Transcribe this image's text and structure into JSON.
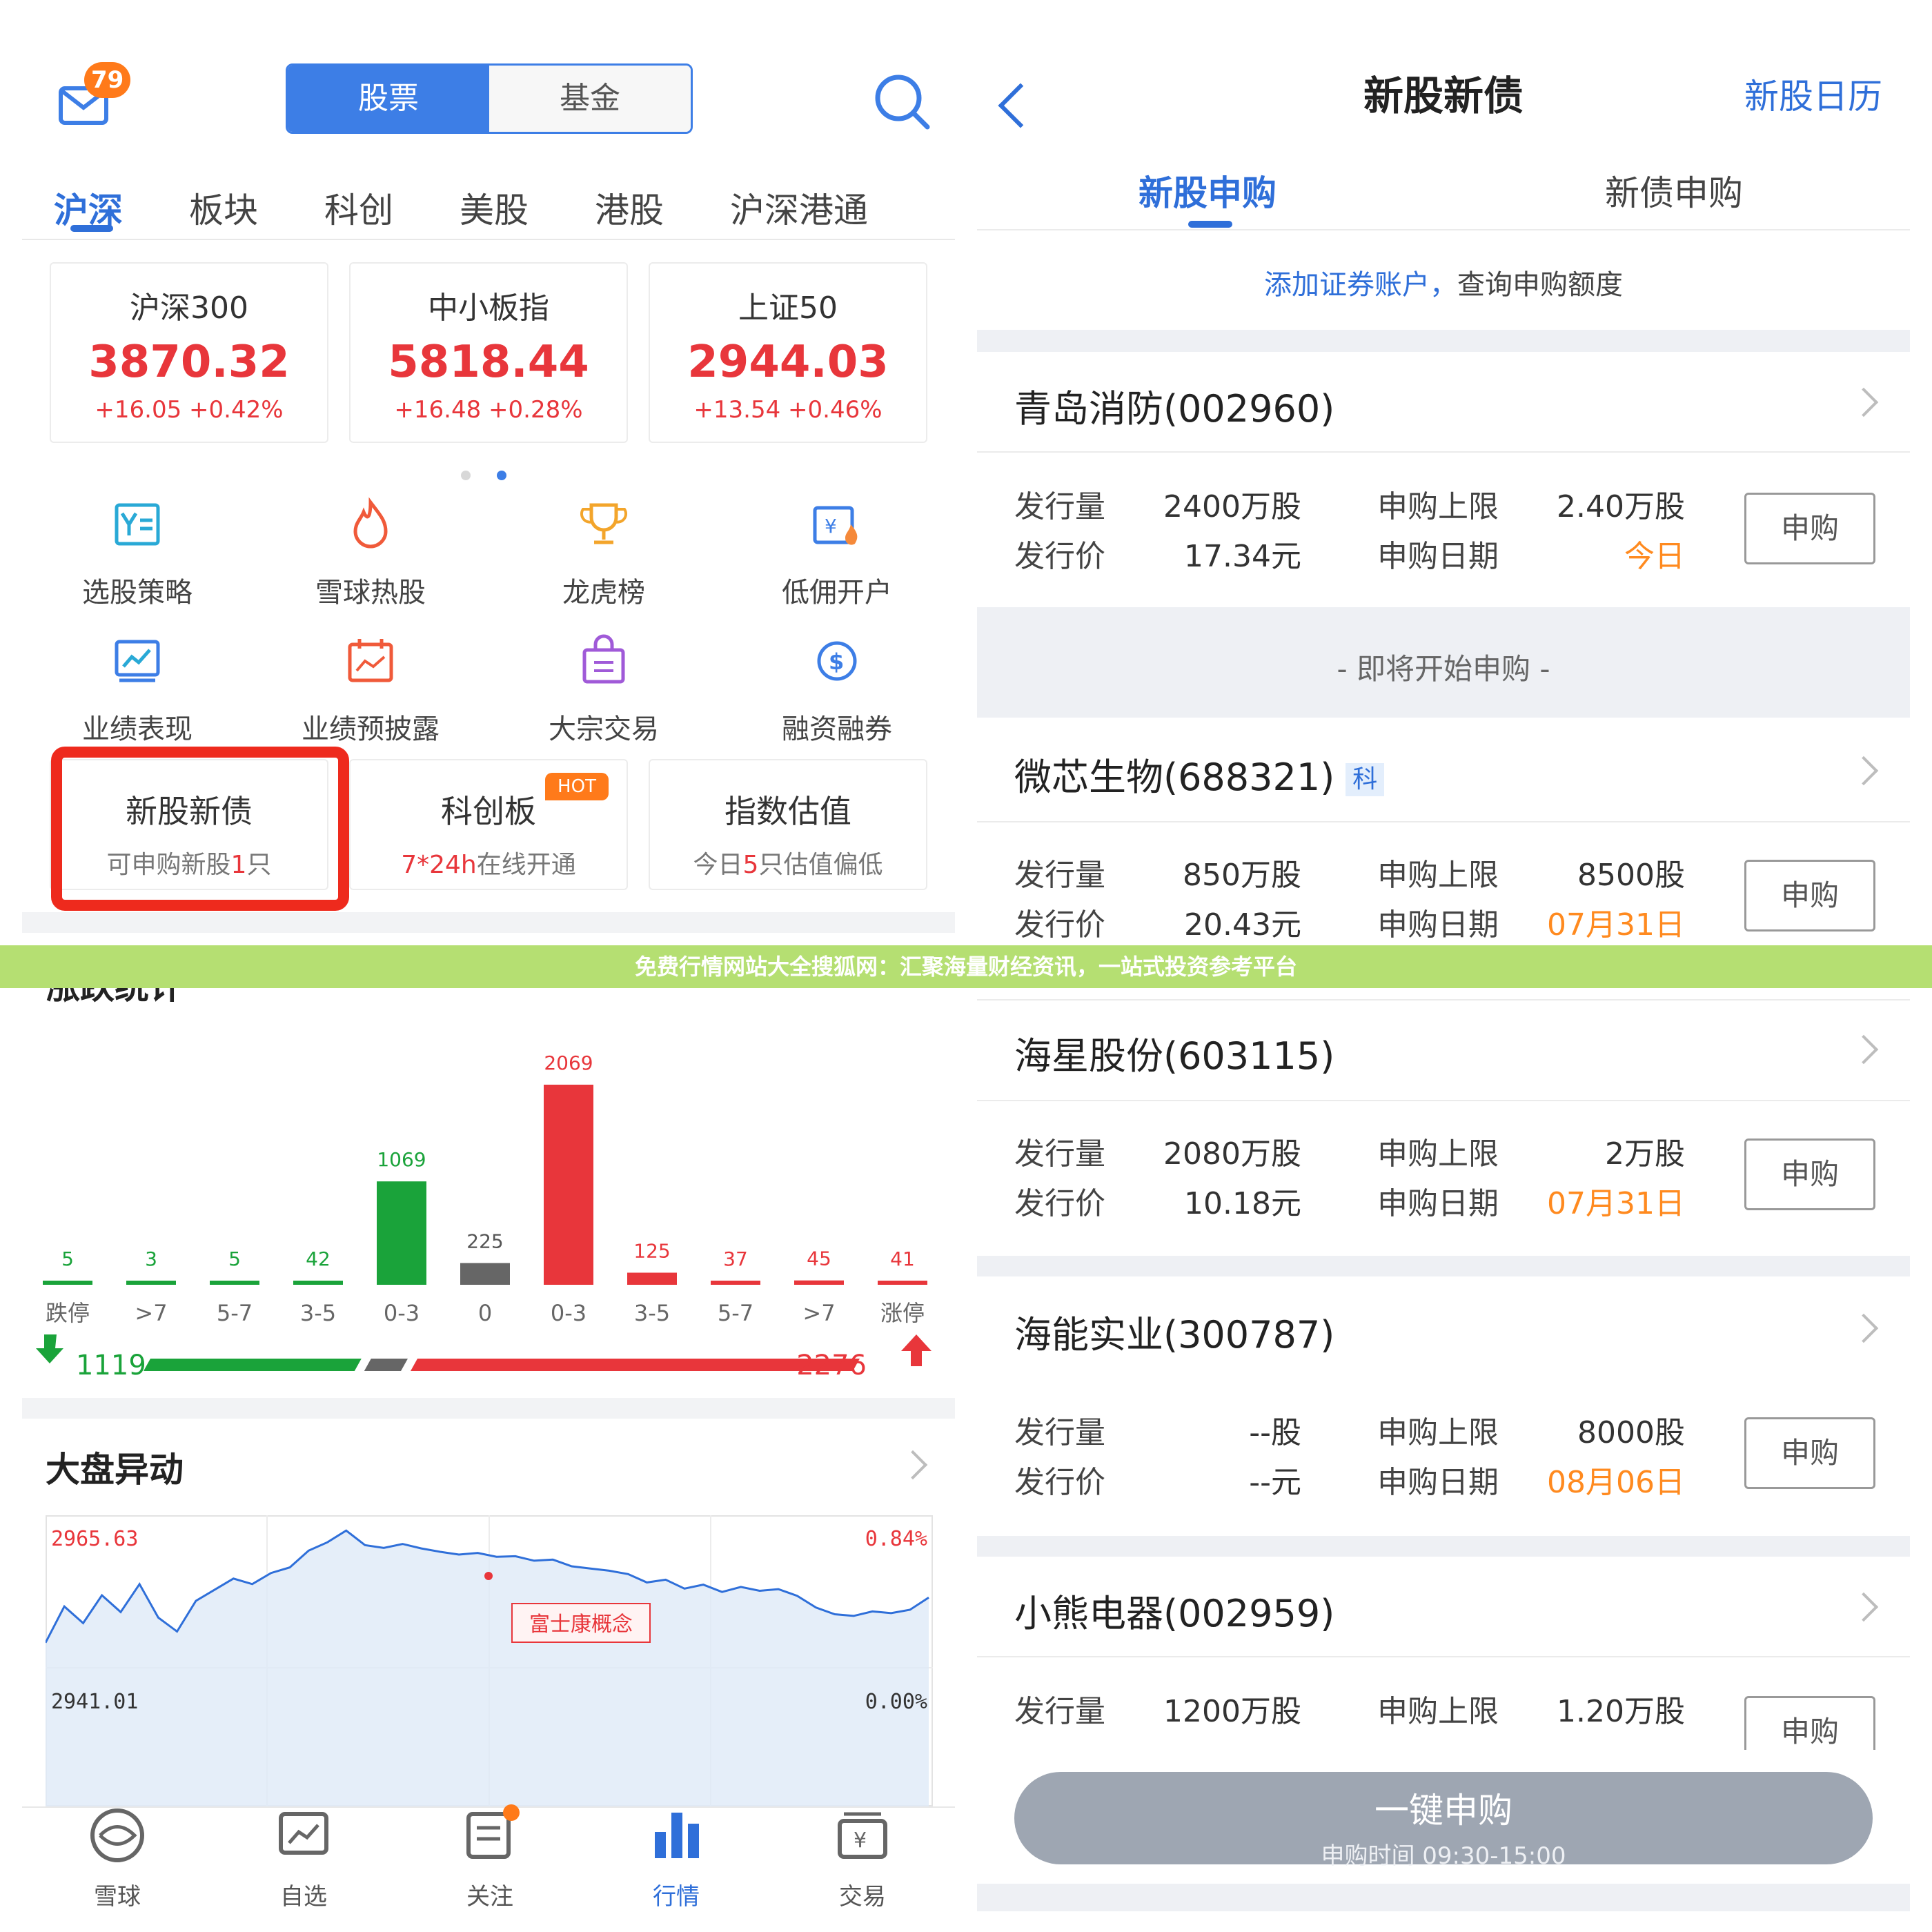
{
  "banner": {
    "text": "免费行情网站大全搜狐网：汇聚海量财经资讯，一站式投资参考平台"
  },
  "left": {
    "header": {
      "mail_badge": "79",
      "seg_stock": "股票",
      "seg_fund": "基金"
    },
    "market_tabs": [
      "沪深",
      "板块",
      "科创",
      "美股",
      "港股",
      "沪深港通"
    ],
    "indices": [
      {
        "name": "沪深300",
        "value": "3870.32",
        "change": "+16.05  +0.42%"
      },
      {
        "name": "中小板指",
        "value": "5818.44",
        "change": "+16.48  +0.28%"
      },
      {
        "name": "上证50",
        "value": "2944.03",
        "change": "+13.54  +0.46%"
      }
    ],
    "menu": [
      "选股策略",
      "雪球热股",
      "龙虎榜",
      "低佣开户",
      "业绩表现",
      "业绩预披露",
      "大宗交易",
      "融资融券"
    ],
    "promos": [
      {
        "title": "新股新债",
        "sub_a": "可申购新股",
        "sub_num": "1",
        "sub_b": "只"
      },
      {
        "title": "科创板",
        "sub_a": "",
        "sub_num": "7*24h",
        "sub_b": "在线开通",
        "badge": "HOT"
      },
      {
        "title": "指数估值",
        "sub_a": "今日",
        "sub_num": "5",
        "sub_b": "只估值偏低"
      }
    ],
    "stats": {
      "title": "涨跌统计",
      "down_total": "1119",
      "up_total": "2276"
    },
    "market_move": {
      "title": "大盘异动",
      "high": "2965.63",
      "low": "2941.01",
      "pct_high": "0.84%",
      "pct_low": "0.00%",
      "tag": "富士康概念"
    },
    "bottom_nav": [
      "雪球",
      "自选",
      "关注",
      "行情",
      "交易"
    ]
  },
  "chart_data": {
    "type": "bar",
    "title": "涨跌统计",
    "categories": [
      "跌停",
      ">7",
      "5-7",
      "3-5",
      "0-3",
      "0",
      "0-3",
      "3-5",
      "5-7",
      ">7",
      "涨停"
    ],
    "values": [
      5,
      3,
      5,
      42,
      1069,
      225,
      2069,
      125,
      37,
      45,
      41
    ],
    "colors": [
      "#1aa33a",
      "#1aa33a",
      "#1aa33a",
      "#1aa33a",
      "#1aa33a",
      "#666666",
      "#e8363b",
      "#e8363b",
      "#e8363b",
      "#e8363b",
      "#e8363b"
    ],
    "ylim": [
      0,
      2069
    ]
  },
  "line_data": {
    "type": "line",
    "ylim": [
      2941.01,
      2965.63
    ],
    "values": [
      2945.5,
      2952,
      2949,
      2954,
      2951,
      2956,
      2950,
      2947.5,
      2953,
      2955,
      2957,
      2956,
      2958,
      2959,
      2962,
      2963.5,
      2965.6,
      2963,
      2962.5,
      2963.2,
      2962.4,
      2961.8,
      2961.3,
      2961.6,
      2960.9,
      2961,
      2960.2,
      2960.4,
      2959.2,
      2958.8,
      2958.4,
      2957.8,
      2956.3,
      2956.8,
      2955.2,
      2955.9,
      2954.6,
      2955.5,
      2954.8,
      2955.1,
      2953.9,
      2951.8,
      2950.6,
      2950.3,
      2951.1,
      2950.8,
      2951.4,
      2953.6
    ]
  },
  "right": {
    "title": "新股新债",
    "calendar": "新股日历",
    "tabs": [
      "新股申购",
      "新债申购"
    ],
    "hint_link": "添加证券账户，",
    "hint_text": "查询申购额度",
    "soon": "- 即将开始申购 -",
    "labels": {
      "vol": "发行量",
      "price": "发行价",
      "limit": "申购上限",
      "date": "申购日期",
      "btn": "申购"
    },
    "stocks": [
      {
        "name": "青岛消防(002960)",
        "vol": "2400万股",
        "price": "17.34元",
        "limit": "2.40万股",
        "date": "今日"
      },
      {
        "name": "微芯生物(688321)",
        "badge": "科",
        "vol": "850万股",
        "price": "20.43元",
        "limit": "8500股",
        "date": "07月31日"
      },
      {
        "name": "海星股份(603115)",
        "vol": "2080万股",
        "price": "10.18元",
        "limit": "2万股",
        "date": "07月31日"
      },
      {
        "name": "海能实业(300787)",
        "vol": "--股",
        "price": "--元",
        "limit": "8000股",
        "date": "08月06日"
      },
      {
        "name": "小熊电器(002959)",
        "vol": "1200万股",
        "limit": "1.20万股"
      }
    ],
    "onekey": {
      "label": "一键申购",
      "time": "申购时间 09:30-15:00"
    }
  }
}
